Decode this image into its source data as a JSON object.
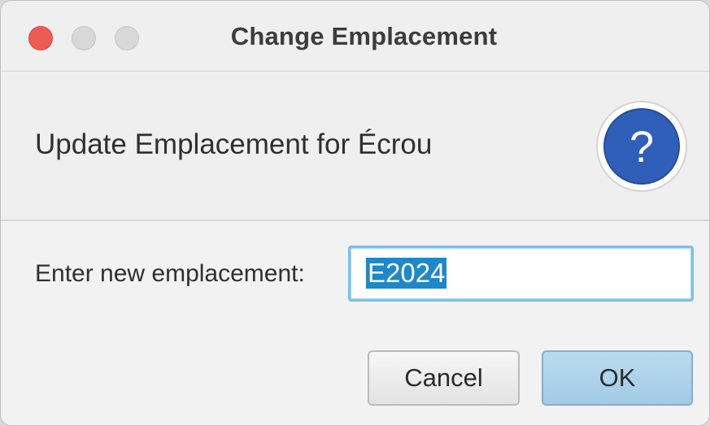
{
  "window": {
    "title": "Change Emplacement"
  },
  "header": {
    "text": "Update Emplacement for Écrou",
    "icon": "question-mark-icon",
    "icon_glyph": "?",
    "icon_color": "#2f5fb8"
  },
  "form": {
    "label": "Enter new emplacement:",
    "value": "E2024"
  },
  "buttons": {
    "cancel": "Cancel",
    "ok": "OK"
  },
  "colors": {
    "close": "#ee5b56",
    "selection": "#1e88c8",
    "focus_ring": "#7ec0ea",
    "default_button": "#a3cbe6"
  }
}
